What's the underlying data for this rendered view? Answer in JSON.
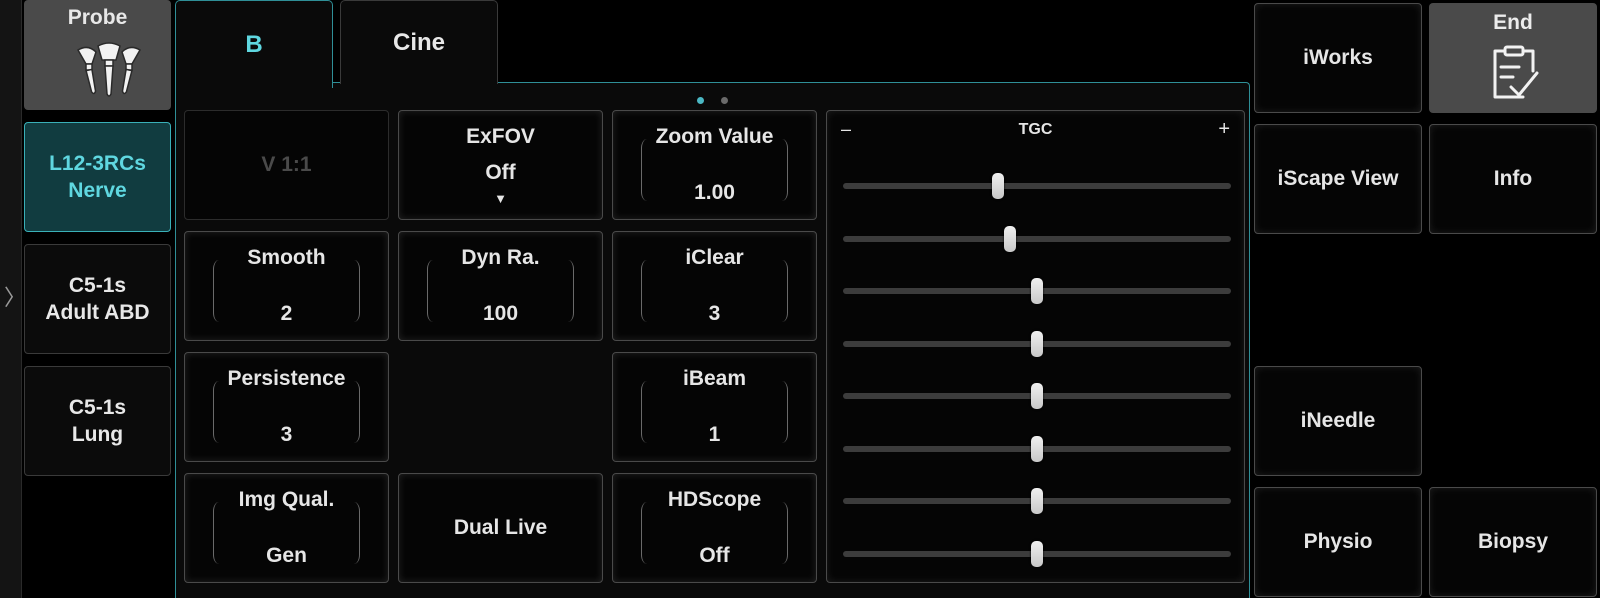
{
  "probe": {
    "header_label": "Probe",
    "items": [
      {
        "label": "L12-3RCs\nNerve",
        "active": true
      },
      {
        "label": "C5-1s\nAdult ABD",
        "active": false
      },
      {
        "label": "C5-1s\nLung",
        "active": false
      }
    ]
  },
  "sidebar": {
    "expand_icon": "chevron-right-icon"
  },
  "tabs": [
    {
      "label": "B",
      "active": true
    },
    {
      "label": "Cine",
      "active": false
    }
  ],
  "pagination": {
    "current": 1,
    "total": 2
  },
  "controls": {
    "v11": {
      "label": "V 1:1",
      "enabled": false
    },
    "exfov": {
      "label": "ExFOV",
      "value": "Off",
      "arrow": "▼"
    },
    "zoom": {
      "label": "Zoom Value",
      "value": "1.00"
    },
    "smooth": {
      "label": "Smooth",
      "value": "2"
    },
    "dynra": {
      "label": "Dyn Ra.",
      "value": "100"
    },
    "iclear": {
      "label": "iClear",
      "value": "3"
    },
    "persistence": {
      "label": "Persistence",
      "value": "3"
    },
    "ibeam": {
      "label": "iBeam",
      "value": "1"
    },
    "imgqual": {
      "label": "Img Qual.",
      "value": "Gen"
    },
    "duallive": {
      "label": "Dual Live"
    },
    "hdscope": {
      "label": "HDScope",
      "value": "Off"
    }
  },
  "tgc": {
    "title": "TGC",
    "minus": "–",
    "plus": "+",
    "levels": [
      0.4,
      0.43,
      0.5,
      0.5,
      0.5,
      0.5,
      0.5,
      0.5
    ]
  },
  "right_buttons": {
    "iworks": "iWorks",
    "end": "End",
    "iscape": "iScape View",
    "info": "Info",
    "ineedle": "iNeedle",
    "physio": "Physio",
    "biopsy": "Biopsy"
  },
  "colors": {
    "accent": "#5fd7e0",
    "accent_border": "#2f8f97",
    "active_bg": "#113c40"
  }
}
